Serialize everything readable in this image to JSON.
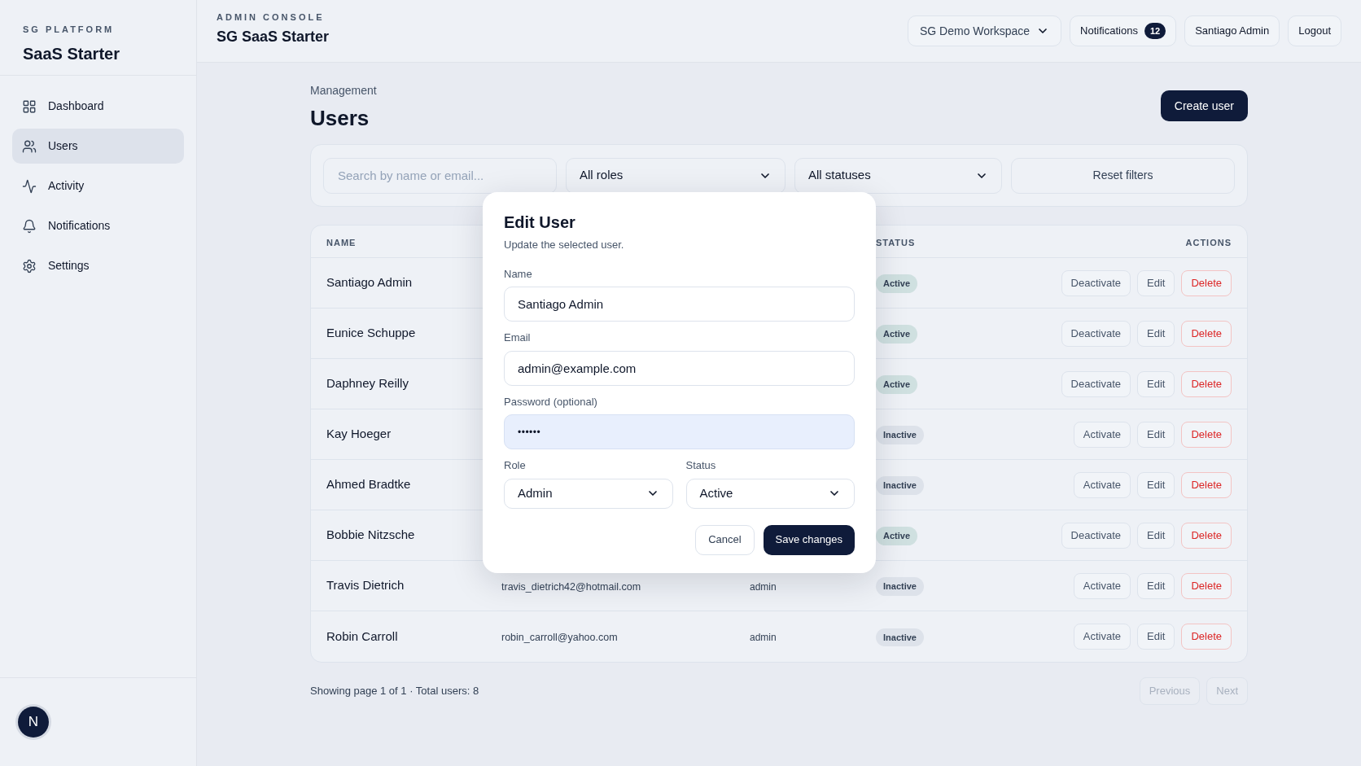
{
  "sidebar": {
    "eyebrow": "SG PLATFORM",
    "title": "SaaS Starter",
    "items": [
      {
        "label": "Dashboard",
        "selected": false
      },
      {
        "label": "Users",
        "selected": true
      },
      {
        "label": "Activity",
        "selected": false
      },
      {
        "label": "Notifications",
        "selected": false
      },
      {
        "label": "Settings",
        "selected": false
      }
    ],
    "avatar": "N"
  },
  "header": {
    "eyebrow": "ADMIN CONSOLE",
    "title": "SG SaaS Starter",
    "workspace": "SG Demo Workspace",
    "notifications": {
      "label": "Notifications",
      "count": "12"
    },
    "user": "Santiago Admin",
    "logout": "Logout"
  },
  "page": {
    "breadcrumb": "Management",
    "title": "Users",
    "create_button": "Create user"
  },
  "filters": {
    "search": {
      "placeholder": "Search by name or email..."
    },
    "role": "All roles",
    "status": "All statuses",
    "reset": "Reset filters"
  },
  "table": {
    "columns": [
      "NAME",
      "STATUS",
      "ACTIONS"
    ],
    "rows": [
      {
        "name": "Santiago Admin",
        "status": "Active",
        "active": true,
        "actions": [
          {
            "label": "Deactivate",
            "kind": "toggle"
          },
          {
            "label": "Edit",
            "kind": "edit"
          },
          {
            "label": "Delete",
            "kind": "danger"
          }
        ]
      },
      {
        "name": "Eunice Schuppe",
        "status": "Active",
        "active": true,
        "actions": [
          {
            "label": "Deactivate",
            "kind": "toggle"
          },
          {
            "label": "Edit",
            "kind": "edit"
          },
          {
            "label": "Delete",
            "kind": "danger"
          }
        ]
      },
      {
        "name": "Daphney Reilly",
        "status": "Active",
        "active": true,
        "actions": [
          {
            "label": "Deactivate",
            "kind": "toggle"
          },
          {
            "label": "Edit",
            "kind": "edit"
          },
          {
            "label": "Delete",
            "kind": "danger"
          }
        ]
      },
      {
        "name": "Kay Hoeger",
        "status": "Inactive",
        "active": false,
        "actions": [
          {
            "label": "Activate",
            "kind": "toggle"
          },
          {
            "label": "Edit",
            "kind": "edit"
          },
          {
            "label": "Delete",
            "kind": "danger"
          }
        ]
      },
      {
        "name": "Ahmed Bradtke",
        "status": "Inactive",
        "active": false,
        "actions": [
          {
            "label": "Activate",
            "kind": "toggle"
          },
          {
            "label": "Edit",
            "kind": "edit"
          },
          {
            "label": "Delete",
            "kind": "danger"
          }
        ]
      },
      {
        "name": "Bobbie Nitzsche",
        "status": "Active",
        "active": true,
        "actions": [
          {
            "label": "Deactivate",
            "kind": "toggle"
          },
          {
            "label": "Edit",
            "kind": "edit"
          },
          {
            "label": "Delete",
            "kind": "danger"
          }
        ]
      },
      {
        "name": "Travis Dietrich",
        "email": "travis_dietrich42@hotmail.com",
        "role": "admin",
        "status": "Inactive",
        "active": false,
        "actions": [
          {
            "label": "Activate",
            "kind": "toggle"
          },
          {
            "label": "Edit",
            "kind": "edit"
          },
          {
            "label": "Delete",
            "kind": "danger"
          }
        ]
      },
      {
        "name": "Robin Carroll",
        "email": "robin_carroll@yahoo.com",
        "role": "admin",
        "status": "Inactive",
        "active": false,
        "actions": [
          {
            "label": "Activate",
            "kind": "toggle"
          },
          {
            "label": "Edit",
            "kind": "edit"
          },
          {
            "label": "Delete",
            "kind": "danger"
          }
        ]
      }
    ]
  },
  "pagination": {
    "summary": "Showing page 1 of 1 · Total users: 8",
    "previous": {
      "label": "Previous",
      "disabled": true
    },
    "next": {
      "label": "Next",
      "disabled": true
    }
  },
  "dialog": {
    "title": "Edit User",
    "subtitle": "Update the selected user.",
    "fields": [
      {
        "label": "Name",
        "kind": "text",
        "value": "Santiago Admin",
        "highlighted": false
      },
      {
        "label": "Email",
        "kind": "text",
        "value": "admin@example.com",
        "highlighted": false
      },
      {
        "label": "Password (optional)",
        "kind": "password",
        "value": "••••••",
        "highlighted": true
      }
    ],
    "selects": [
      {
        "label": "Role",
        "value": "Admin"
      },
      {
        "label": "Status",
        "value": "Active"
      }
    ],
    "cancel": "Cancel",
    "save": "Save changes"
  }
}
